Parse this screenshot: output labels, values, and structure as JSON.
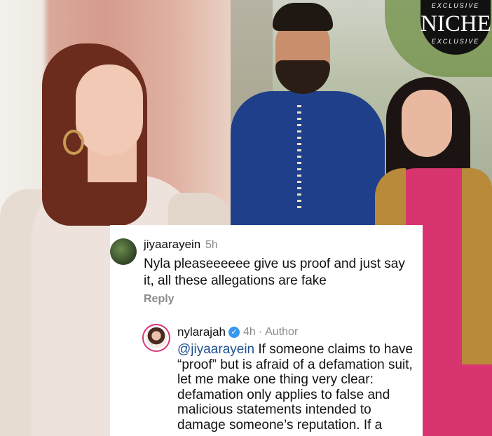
{
  "logo": {
    "top_text": "EXCLUSIVE",
    "main_text": "NICHE",
    "bottom_text": "EXCLUSIVE"
  },
  "comments": [
    {
      "username": "jiyaarayein",
      "time": "5h",
      "text": "Nyla pleaseeeeee give us proof and just say it, all these allegations are fake",
      "reply_label": "Reply"
    },
    {
      "username": "nylarajah",
      "verified": true,
      "time": "4h",
      "separator": "·",
      "author_label": "Author",
      "mention": "@jiyaarayein",
      "text": " If someone claims to have “proof” but is afraid of a defamation suit, let me make one thing very clear: defamation only applies to false and malicious statements intended to damage someone’s reputation. If a"
    }
  ],
  "colors": {
    "verified_badge": "#3897f0",
    "mention": "#1d4f91",
    "muted_text": "#8a8a8a"
  },
  "icons": {
    "verified": "verified-badge-icon"
  }
}
